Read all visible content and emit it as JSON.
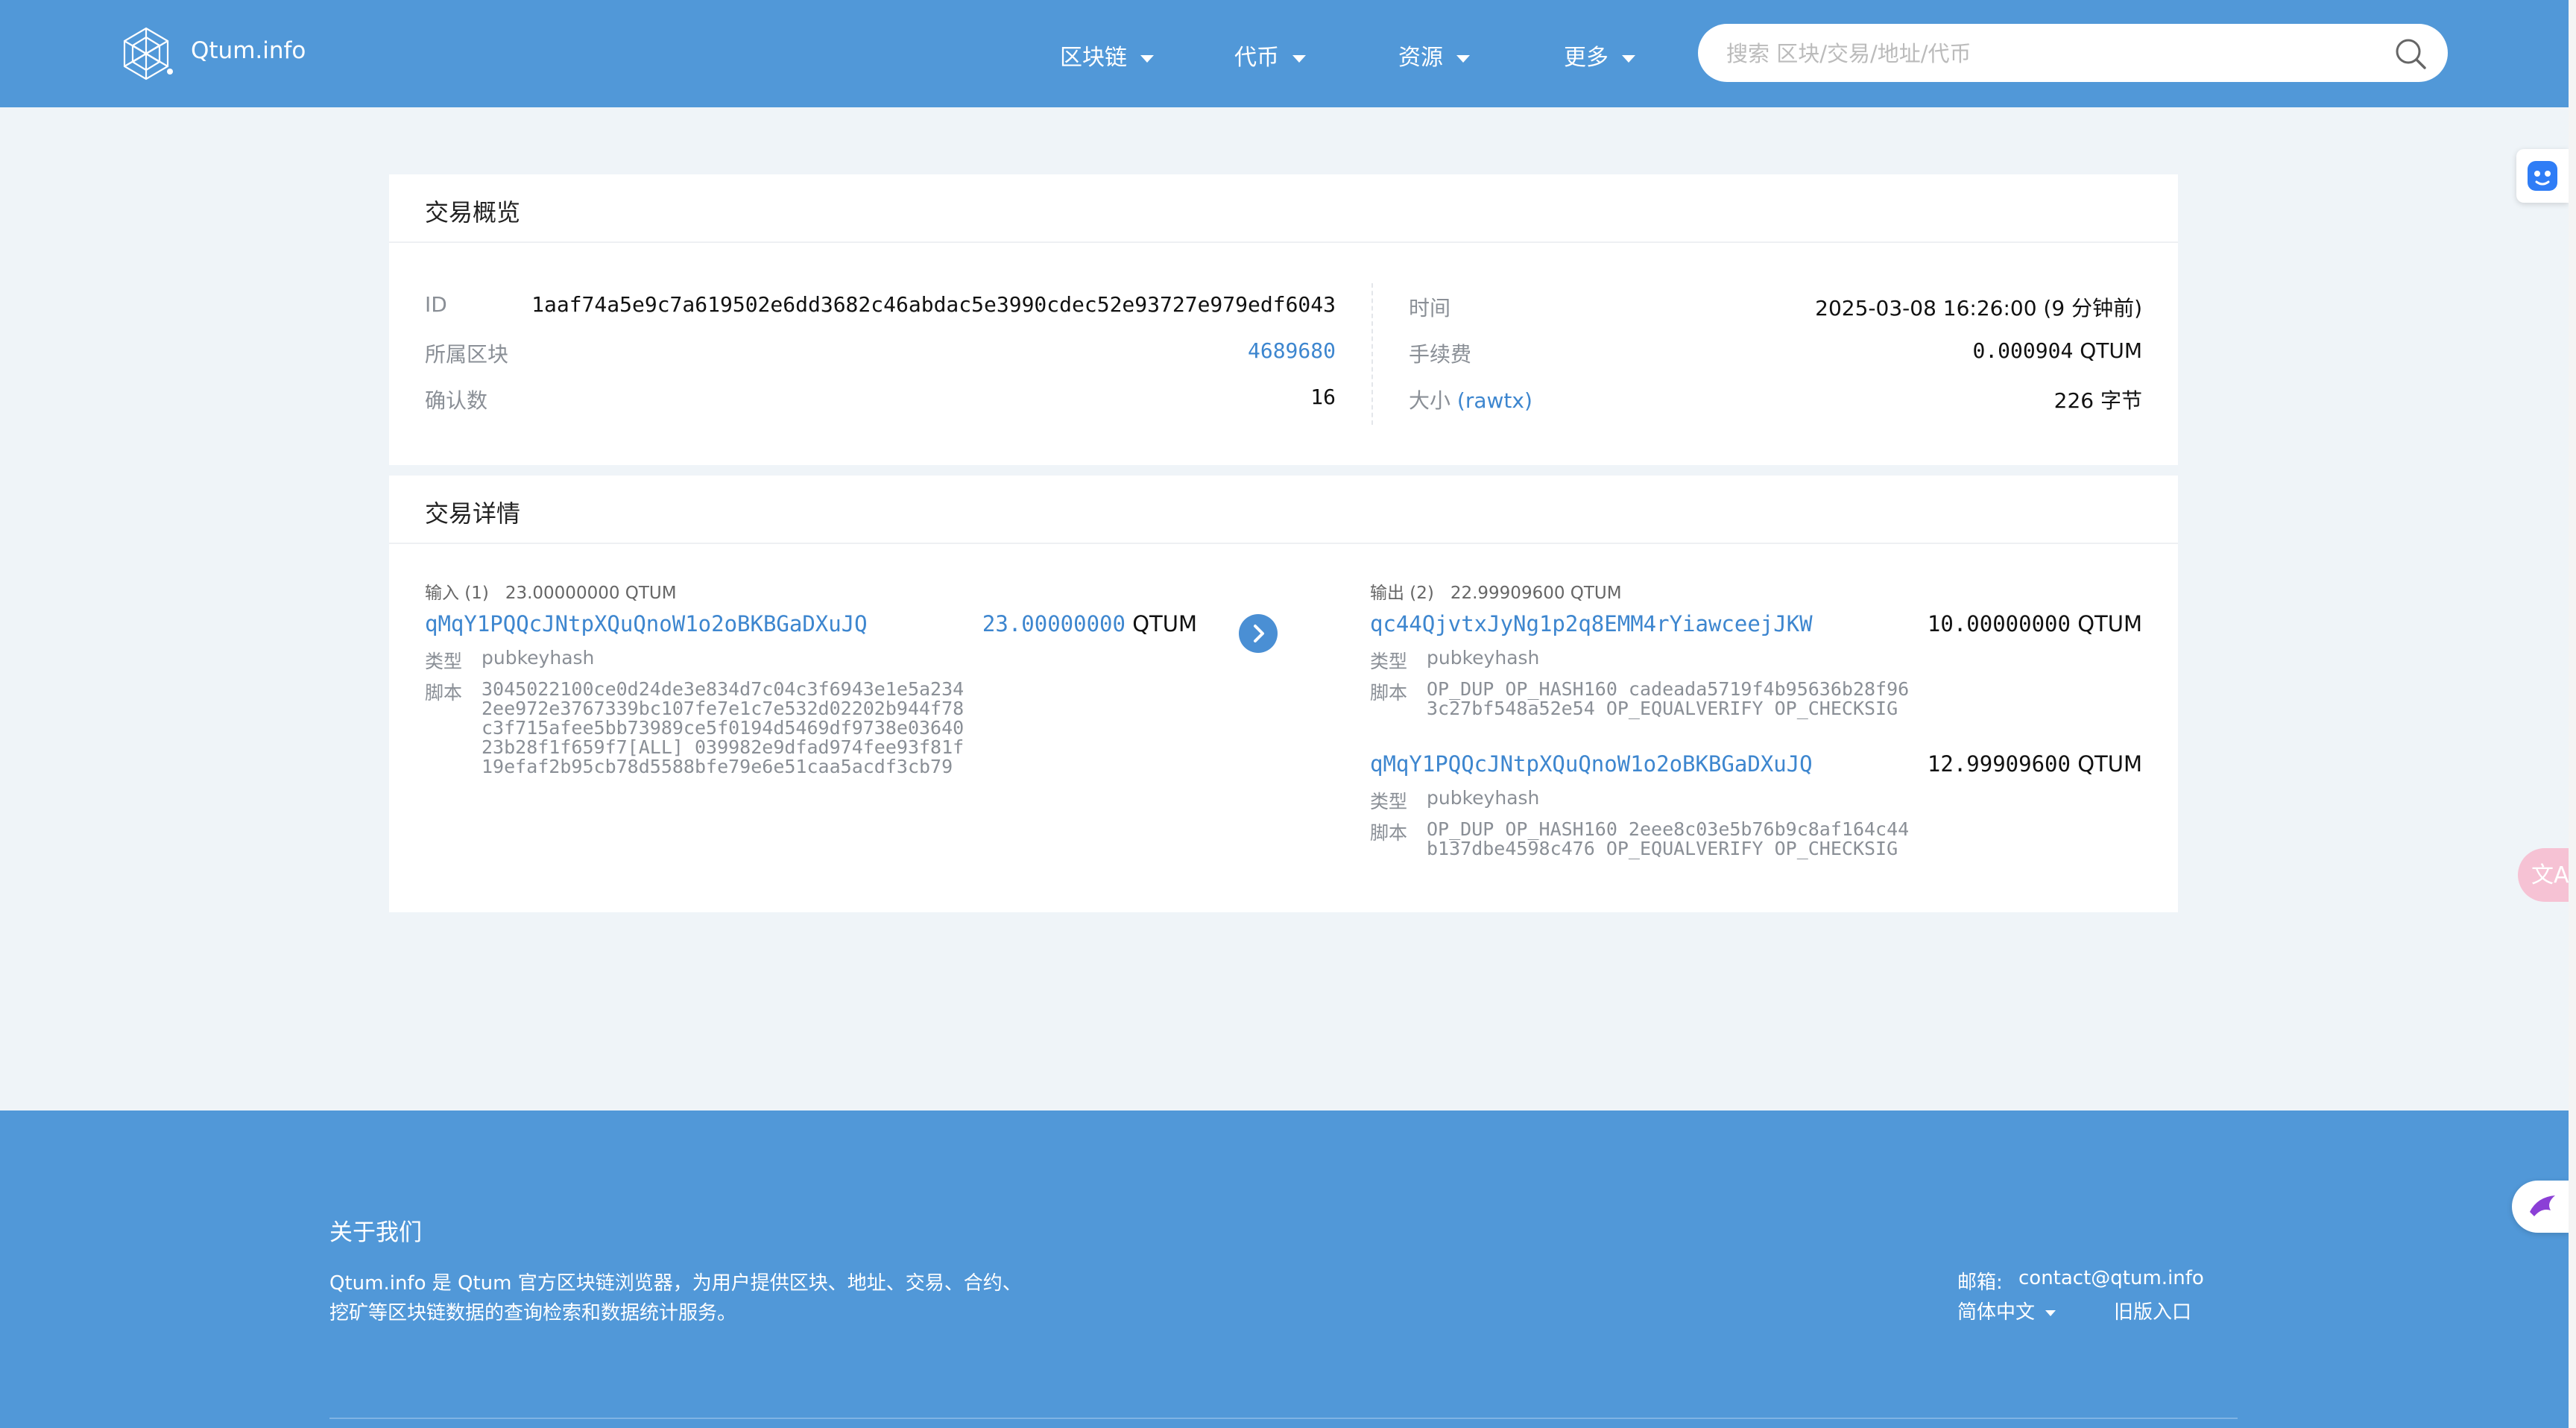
{
  "header": {
    "brand": "Qtum.info",
    "nav": [
      {
        "label": "区块链"
      },
      {
        "label": "代币"
      },
      {
        "label": "资源"
      },
      {
        "label": "更多"
      }
    ],
    "search_placeholder": "搜索 区块/交易/地址/代币"
  },
  "overview": {
    "title": "交易概览",
    "id_label": "ID",
    "id_value": "1aaf74a5e9c7a619502e6dd3682c46abdac5e3990cdec52e93727e979edf6043",
    "block_label": "所属区块",
    "block_value": "4689680",
    "confirm_label": "确认数",
    "confirm_value": "16",
    "time_label": "时间",
    "time_value": "2025-03-08 16:26:00 (9 分钟前)",
    "fee_label": "手续费",
    "fee_value": "0.000904",
    "fee_unit": "QTUM",
    "size_label": "大小",
    "rawtx": "(rawtx)",
    "size_value": "226 字节"
  },
  "details": {
    "title": "交易详情",
    "inputs": {
      "head": "输入 (1)",
      "total": "23.00000000 QTUM",
      "items": [
        {
          "address": "qMqY1PQQcJNtpXQuQnoW1o2oBKBGaDXuJQ",
          "amount": "23.00000000",
          "unit": "QTUM",
          "type_label": "类型",
          "type": "pubkeyhash",
          "script_label": "脚本",
          "script": "3045022100ce0d24de3e834d7c04c3f6943e1e5a2342ee972e3767339bc107fe7e1c7e532d02202b944f78c3f715afee5bb73989ce5f0194d5469df9738e0364023b28f1f659f7[ALL] 039982e9dfad974fee93f81f19efaf2b95cb78d5588bfe79e6e51caa5acdf3cb79"
        }
      ]
    },
    "outputs": {
      "head": "输出 (2)",
      "total": "22.99909600 QTUM",
      "items": [
        {
          "address": "qc44QjvtxJyNg1p2q8EMM4rYiawceejJKW",
          "amount": "10.00000000",
          "unit": "QTUM",
          "type_label": "类型",
          "type": "pubkeyhash",
          "script_label": "脚本",
          "script": "OP_DUP OP_HASH160 cadeada5719f4b95636b28f963c27bf548a52e54 OP_EQUALVERIFY OP_CHECKSIG"
        },
        {
          "address": "qMqY1PQQcJNtpXQuQnoW1o2oBKBGaDXuJQ",
          "amount": "12.99909600",
          "unit": "QTUM",
          "type_label": "类型",
          "type": "pubkeyhash",
          "script_label": "脚本",
          "script": "OP_DUP OP_HASH160 2eee8c03e5b76b9c8af164c44b137dbe4598c476 OP_EQUALVERIFY OP_CHECKSIG"
        }
      ]
    }
  },
  "footer": {
    "about_title": "关于我们",
    "about_text": "Qtum.info 是 Qtum 官方区块链浏览器，为用户提供区块、地址、交易、合约、挖矿等区块链数据的查询检索和数据统计服务。",
    "email_label": "邮箱:",
    "email": "contact@qtum.info",
    "language": "简体中文",
    "old_version": "旧版入口"
  },
  "icons": {
    "logo": "qtum-logo-icon",
    "search": "search-icon",
    "arrow": "chevron-right-icon"
  },
  "colors": {
    "primary": "#5198d8",
    "link": "#3d86cf",
    "bg": "#eff4f8"
  }
}
